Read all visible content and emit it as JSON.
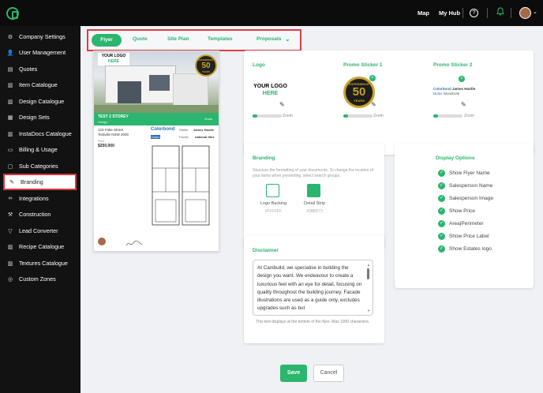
{
  "topbar": {
    "map": "Map",
    "my_hub": "My Hub"
  },
  "sidebar": {
    "items": [
      {
        "label": "Company Settings",
        "icon": "gear-icon"
      },
      {
        "label": "User Management",
        "icon": "user-icon"
      },
      {
        "label": "Quotes",
        "icon": "document-icon"
      },
      {
        "label": "Item Catalogue",
        "icon": "book-icon"
      },
      {
        "label": "Design Catalogue",
        "icon": "book-icon"
      },
      {
        "label": "Design Sets",
        "icon": "layers-icon"
      },
      {
        "label": "InstaDocs Catalogue",
        "icon": "book-icon"
      },
      {
        "label": "Billing & Usage",
        "icon": "card-icon"
      },
      {
        "label": "Sub Categories",
        "icon": "folder-icon"
      },
      {
        "label": "Branding",
        "icon": "brush-icon"
      },
      {
        "label": "Integrations",
        "icon": "link-icon"
      },
      {
        "label": "Construction",
        "icon": "hammer-icon"
      },
      {
        "label": "Lead Converter",
        "icon": "funnel-icon"
      },
      {
        "label": "Recipe Catalogue",
        "icon": "book-icon"
      },
      {
        "label": "Textures Catalogue",
        "icon": "book-icon"
      },
      {
        "label": "Custom Zones",
        "icon": "zone-icon"
      }
    ]
  },
  "tabs": [
    {
      "label": "Flyer"
    },
    {
      "label": "Quote"
    },
    {
      "label": "Site Plan"
    },
    {
      "label": "Templates"
    },
    {
      "label": "Proposals"
    }
  ],
  "flyer": {
    "logo_line1": "YOUR LOGO",
    "logo_line2": "HERE",
    "sticker_top": "EXPERIENCE",
    "sticker_num": "50",
    "sticker_bottom": "YEARS",
    "design_name": "TEST 2 STOREY",
    "design_sub": "Design",
    "zoom_label": "Zoom",
    "address1": "123 Fake Street",
    "address2": "Testville NSW 2000",
    "price_label": "From",
    "price": "$250,000",
    "brand1": "Colorbond",
    "brand2": "Dulux",
    "brand3": "James Hardie",
    "brand4": "national tiles",
    "brand5": "Fisher",
    "brand6": "Pacific"
  },
  "logo_section": {
    "title": "Logo",
    "line1": "YOUR LOGO",
    "line2": "HERE",
    "zoom": "Zoom"
  },
  "promo1": {
    "title": "Promo Sticker 1",
    "zoom": "Zoom",
    "top": "EXPERIENCE",
    "num": "50",
    "bottom": "YEARS"
  },
  "promo2": {
    "title": "Promo Sticker 2",
    "zoom": "Zoom",
    "brand1": "Colorbond",
    "brand2": "James Hardie",
    "brand3": "Dulux",
    "brand4": "Woodnote"
  },
  "branding": {
    "title": "Branding",
    "desc": "Structure the formatting of your documents. To change the location of your items when presenting, select search groups.",
    "logo_backing": "Logo Backing",
    "logo_backing_hex": "#FFFFFF",
    "detail_strip": "Detail Strip",
    "detail_strip_hex": "#2BB573"
  },
  "display": {
    "title": "Display Options",
    "options": [
      "Show Flyer Name",
      "Salesperson Name",
      "Salesperson Image",
      "Show Price",
      "Area|Perimeter",
      "Show Price Label",
      "Show Estates logo"
    ]
  },
  "disclaimer": {
    "title": "Disclaimer",
    "text": "At Canibuild, we specialise in building the design you want. We endeavour to create a luxurious feel  with an eye for detail, focusing on quality throughout the building journey. Facade illustrations are used as a guide only, excludes upgrades such as but",
    "helper": "This text displays at the bottom of the flyer. Max 1000 characters."
  },
  "actions": {
    "save": "Save",
    "cancel": "Cancel"
  },
  "colors": {
    "accent": "#2BB56E",
    "highlight": "#E13B43",
    "sidebar": "#121212"
  }
}
